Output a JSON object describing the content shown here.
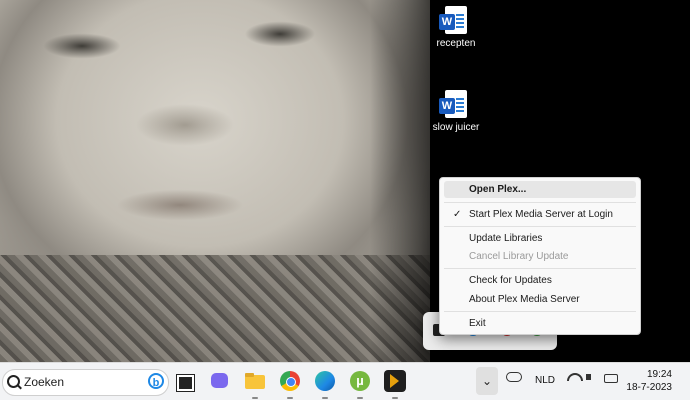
{
  "desktop": {
    "icons": [
      {
        "label": "recepten"
      },
      {
        "label": "slow juicer"
      }
    ]
  },
  "context_menu": {
    "items": [
      {
        "label": "Open Plex...",
        "style": "bold"
      },
      {
        "label": "Start Plex Media Server at Login",
        "checked": true
      },
      {
        "label": "Update Libraries"
      },
      {
        "label": "Cancel Library Update",
        "disabled": true
      },
      {
        "label": "Check for Updates"
      },
      {
        "label": "About Plex Media Server"
      },
      {
        "label": "Exit"
      }
    ],
    "check_glyph": "✓"
  },
  "taskbar": {
    "search": {
      "placeholder": "Zoeken"
    },
    "apps": [
      "task-view-icon",
      "teams-icon",
      "file-explorer-icon",
      "chrome-icon",
      "edge-icon",
      "utorrent-icon",
      "plex-icon"
    ],
    "chevron": "⌄",
    "language": "NLD",
    "clock": {
      "time": "19:24",
      "date": "18-7-2023"
    }
  },
  "colors": {
    "word_blue": "#185abd",
    "taskbar_bg": "#f2f3f5",
    "menu_bg": "#f9f9f9"
  }
}
